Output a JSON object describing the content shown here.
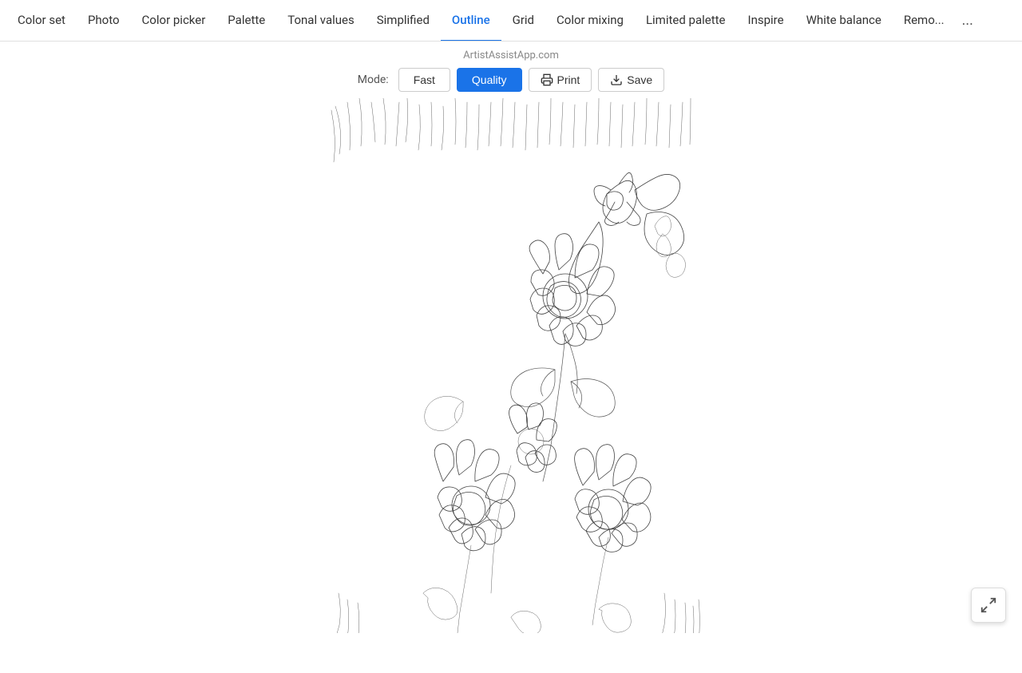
{
  "nav": {
    "items": [
      {
        "label": "Color set",
        "active": false
      },
      {
        "label": "Photo",
        "active": false
      },
      {
        "label": "Color picker",
        "active": false
      },
      {
        "label": "Palette",
        "active": false
      },
      {
        "label": "Tonal values",
        "active": false
      },
      {
        "label": "Simplified",
        "active": false
      },
      {
        "label": "Outline",
        "active": true
      },
      {
        "label": "Grid",
        "active": false
      },
      {
        "label": "Color mixing",
        "active": false
      },
      {
        "label": "Limited palette",
        "active": false
      },
      {
        "label": "Inspire",
        "active": false
      },
      {
        "label": "White balance",
        "active": false
      },
      {
        "label": "Remo...",
        "active": false
      }
    ],
    "more_label": "..."
  },
  "app_url": "ArtistAssistApp.com",
  "toolbar": {
    "mode_label": "Mode:",
    "fast_label": "Fast",
    "quality_label": "Quality",
    "print_label": "Print",
    "save_label": "Save"
  },
  "fullscreen": {
    "tooltip": "Fullscreen"
  }
}
